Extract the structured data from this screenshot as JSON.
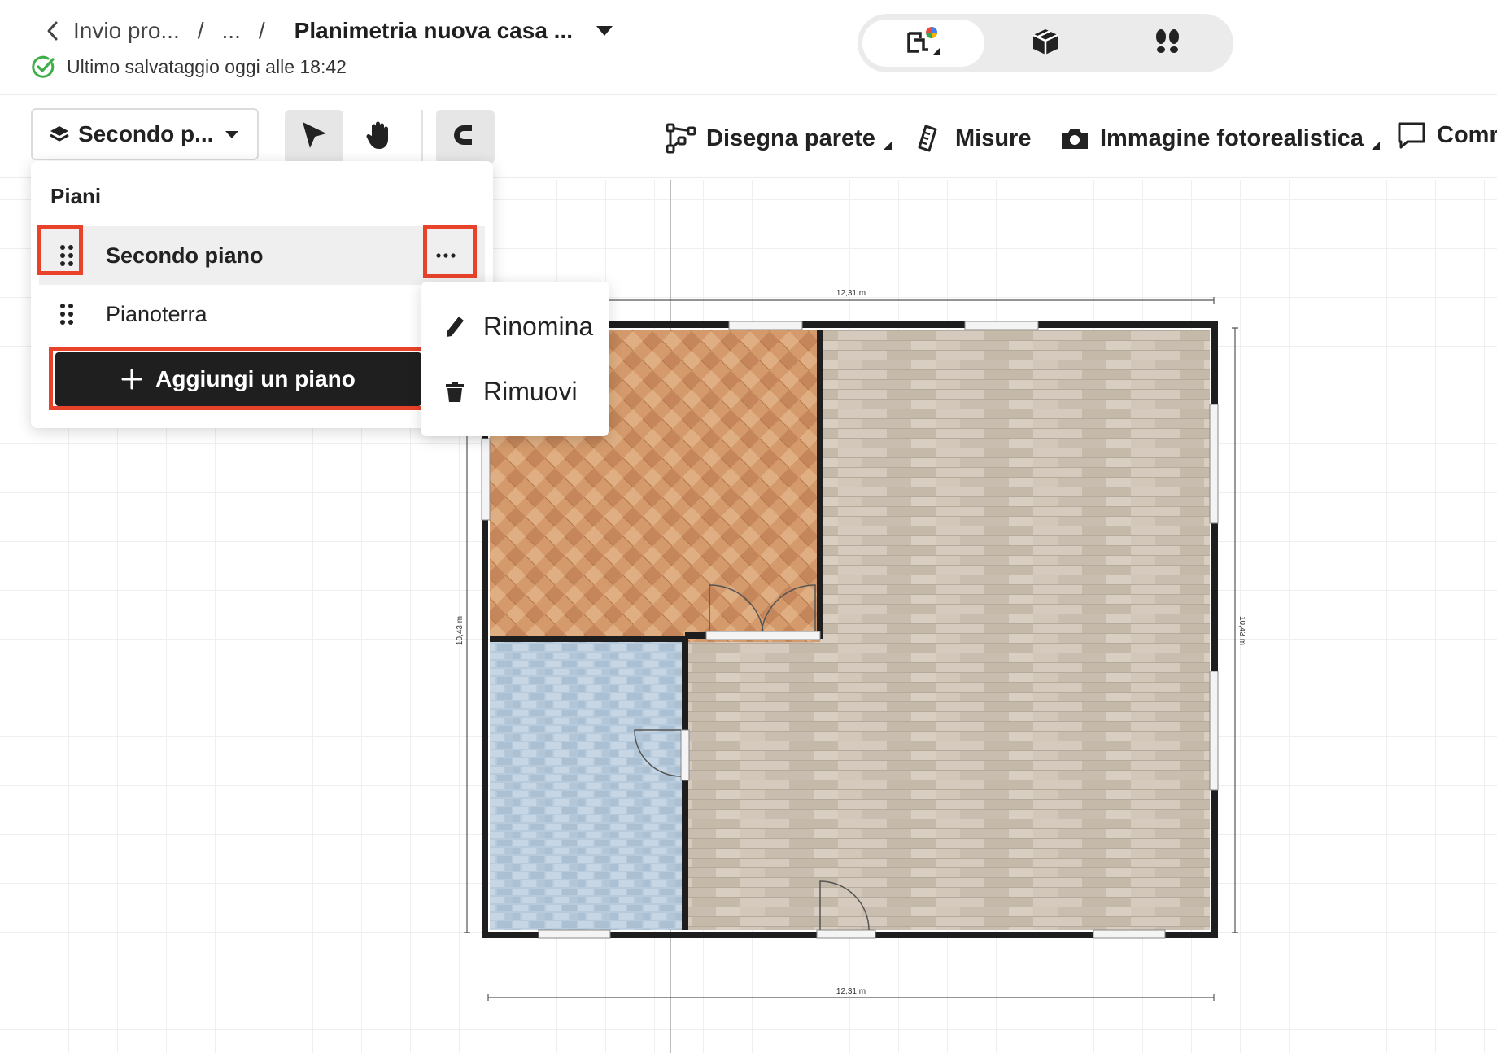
{
  "header": {
    "breadcrumb": {
      "items": [
        "Invio pro...",
        "..."
      ],
      "separator": "/",
      "current": "Planimetria nuova casa ..."
    },
    "save_status": "Ultimo salvataggio oggi alle 18:42",
    "view_modes": [
      {
        "icon": "floorplan-2d-icon",
        "active": true
      },
      {
        "icon": "cube-3d-icon",
        "active": false
      },
      {
        "icon": "walkthrough-footprints-icon",
        "active": false
      }
    ]
  },
  "toolbar": {
    "floor_select_label": "Secondo p...",
    "tools": [
      {
        "icon": "pointer-icon",
        "active": true
      },
      {
        "icon": "pan-hand-icon",
        "active": false
      },
      {
        "icon": "magnet-icon",
        "active": true
      }
    ],
    "actions": [
      {
        "label": "Disegna parete",
        "icon": "draw-wall-icon",
        "has_submenu": true
      },
      {
        "label": "Misure",
        "icon": "ruler-icon",
        "has_submenu": false
      },
      {
        "label": "Immagine fotorealistica",
        "icon": "camera-icon",
        "has_submenu": true
      },
      {
        "label": "Comm",
        "icon": "comment-icon",
        "has_submenu": false
      }
    ]
  },
  "floors_panel": {
    "title": "Piani",
    "floors": [
      {
        "label": "Secondo piano",
        "selected": true
      },
      {
        "label": "Pianoterra",
        "selected": false
      }
    ],
    "add_button": "Aggiungi un piano"
  },
  "context_menu": {
    "items": [
      {
        "label": "Rinomina",
        "icon": "pencil-icon"
      },
      {
        "label": "Rimuovi",
        "icon": "trash-icon"
      }
    ]
  },
  "plan": {
    "dimensions": {
      "top": "12,31 m",
      "bottom": "12,31 m",
      "left": "10,43 m",
      "right": "10,43 m"
    }
  },
  "colors": {
    "highlight": "#e8432a",
    "wall": "#1e1e1e",
    "parquet": "#d39a6e",
    "tile": "#b7cadb",
    "planks": "#cdc2b4"
  }
}
